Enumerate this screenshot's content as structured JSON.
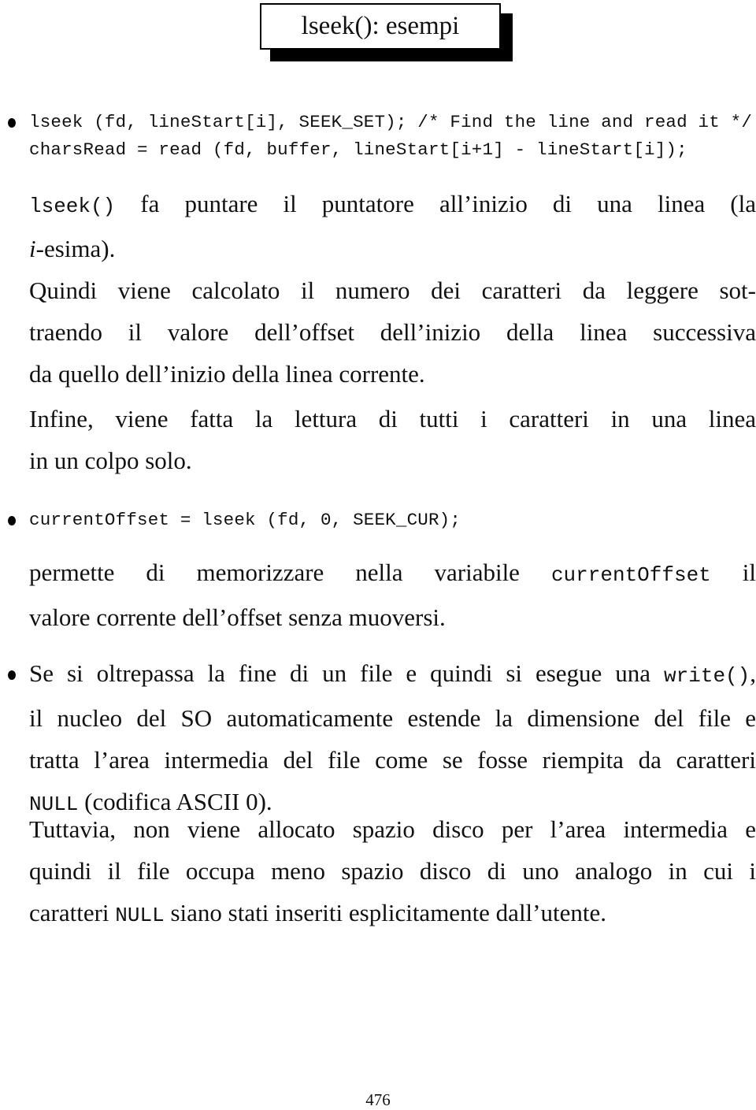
{
  "title": "lseek(): esempi",
  "bullets": [
    {
      "code_lines": [
        "lseek (fd, lineStart[i], SEEK_SET); /* Find the line and read it */",
        "charsRead = read (fd, buffer, lineStart[i+1] - lineStart[i]);"
      ],
      "desc_para_1": {
        "code": "lseek()",
        "line1_rest": " fa puntare il puntatore all’inizio di una linea (la",
        "italic_i": "i",
        "line2_rest": "-esima)."
      },
      "desc_para_2": [
        "Quindi viene calcolato il numero dei caratteri da leggere sot-",
        "traendo il valore dell’offset dell’inizio della linea successiva",
        "da quello dell’inizio della linea corrente."
      ],
      "desc_para_3": [
        "Infine, viene fatta la lettura di tutti i caratteri in una linea",
        "in un colpo solo."
      ]
    },
    {
      "code_line": "currentOffset = lseek (fd, 0, SEEK_CUR);",
      "desc": {
        "before": "permette di memorizzare nella variabile ",
        "code": "currentOffset",
        "after": " il",
        "line2": "valore corrente dell’offset senza muoversi."
      }
    },
    {
      "para_1": {
        "line1_before": "Se si oltrepassa la fine di un file e quindi si esegue una ",
        "line1_code": "write()",
        "line1_after": ",",
        "line2": "il nucleo del SO automaticamente estende la dimensione del file e",
        "line3": "tratta l’area intermedia del file come se fosse riempita da caratteri",
        "line4_code": "NULL",
        "line4_after": " (codifica ASCII 0)."
      },
      "para_2": {
        "line1": "Tuttavia, non viene allocato spazio disco per l’area intermedia e",
        "line2": "quindi il file occupa meno spazio disco di uno analogo in cui i",
        "line3_before": "caratteri ",
        "line3_code": "NULL",
        "line3_after": " siano stati inseriti esplicitamente dall’utente."
      }
    }
  ],
  "page_number": "476"
}
